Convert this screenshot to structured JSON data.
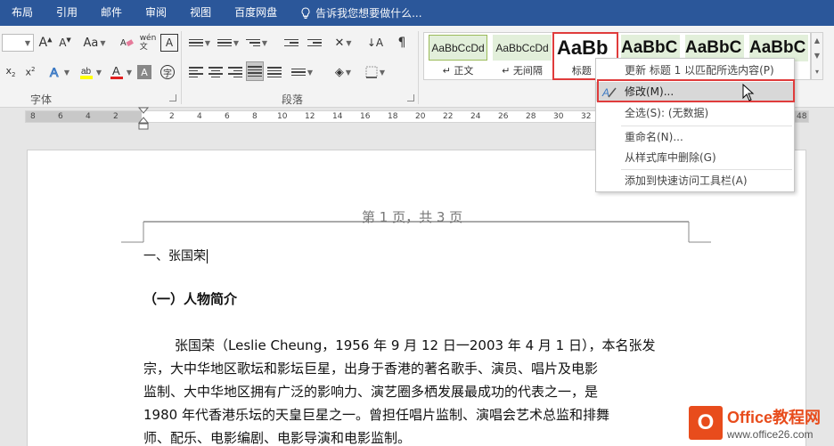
{
  "menu": {
    "tabs": [
      "布局",
      "引用",
      "邮件",
      "审阅",
      "视图",
      "百度网盘"
    ],
    "tell_me": "告诉我您想要做什么..."
  },
  "ribbon": {
    "font_group_label": "字体",
    "paragraph_group_label": "段落",
    "change_case": "Aa"
  },
  "styles": [
    {
      "preview": "AaBbCcDd",
      "name": "↵ 正文"
    },
    {
      "preview": "AaBbCcDd",
      "name": "↵ 无间隔"
    },
    {
      "preview": "AaBb",
      "name": "标题 1"
    },
    {
      "preview": "AaBbC",
      "name": ""
    },
    {
      "preview": "AaBbC",
      "name": ""
    },
    {
      "preview": "AaBbC",
      "name": ""
    }
  ],
  "ruler": {
    "numbers": [
      "8",
      "6",
      "4",
      "2",
      "2",
      "4",
      "6",
      "8",
      "10",
      "12",
      "14",
      "16",
      "18",
      "20",
      "22",
      "24",
      "26",
      "28",
      "30",
      "32",
      "48"
    ]
  },
  "document": {
    "header": "第 1 页，共 3 页",
    "heading1": "一、张国荣",
    "heading2": "（一）人物简介",
    "para_lines": [
      "张国荣（Leslie Cheung，1956 年 9 月 12 日一2003 年 4 月 1 日），本名张发",
      "宗，大中华地区歌坛和影坛巨星，出身于香港的著名歌手、演员、唱片及电影",
      "监制、大中华地区拥有广泛的影响力、演艺圈多栖发展最成功的代表之一，是",
      "1980 年代香港乐坛的天皇巨星之一。曾担任唱片监制、演唱会艺术总监和排舞",
      "师、配乐、电影编剧、电影导演和电影监制。"
    ]
  },
  "context_menu": {
    "items": [
      "更新 标题 1 以匹配所选内容(P)",
      "修改(M)...",
      "全选(S): (无数据)",
      "重命名(N)...",
      "从样式库中删除(G)",
      "添加到快速访问工具栏(A)"
    ]
  },
  "watermark": {
    "brand": "Office教程网",
    "url": "www.office26.com"
  },
  "colors": {
    "title_bar": "#2b579a",
    "highlight": "#e03c3c",
    "style_bg": "#e2efda"
  }
}
